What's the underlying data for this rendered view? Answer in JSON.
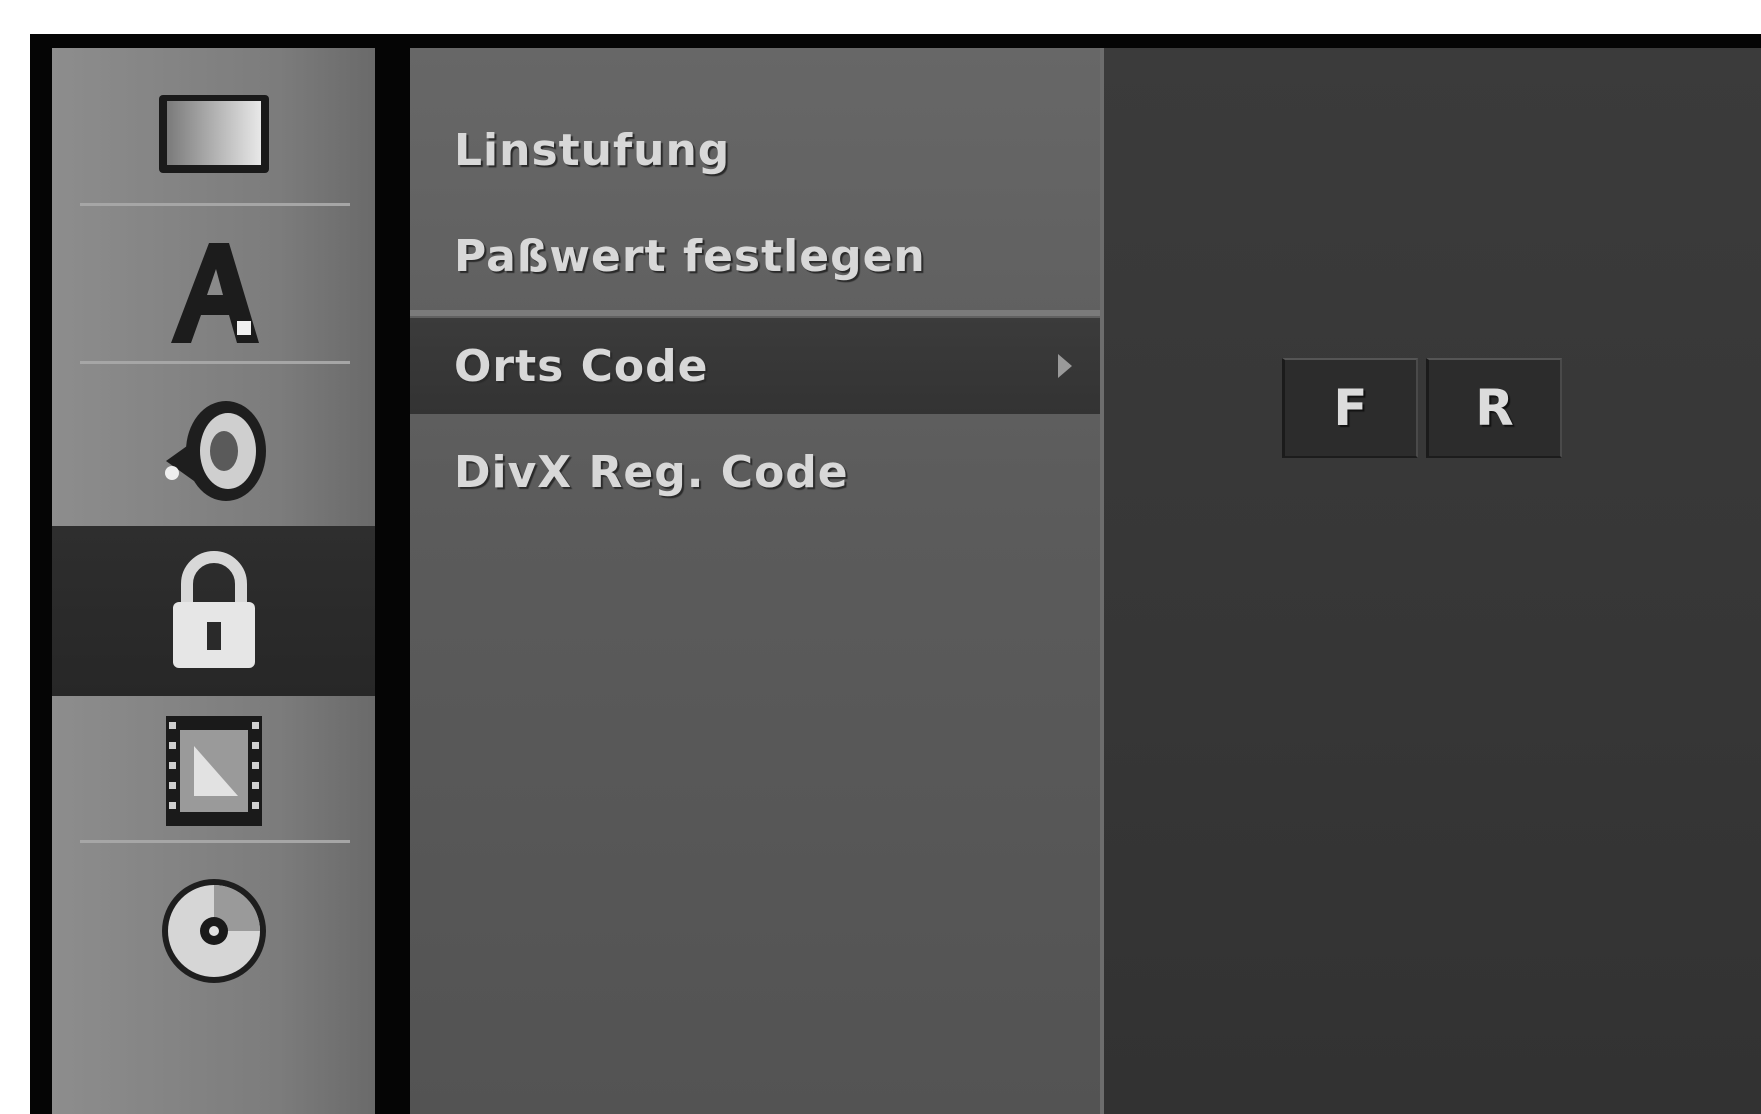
{
  "sidebar": {
    "items": [
      {
        "icon": "display-icon"
      },
      {
        "icon": "language-icon"
      },
      {
        "icon": "speaker-icon"
      },
      {
        "icon": "lock-icon",
        "active": true
      },
      {
        "icon": "film-icon"
      },
      {
        "icon": "disc-icon"
      }
    ]
  },
  "menu": {
    "items": [
      {
        "label": "Linstufung"
      },
      {
        "label": "Paßwert festlegen"
      },
      {
        "label": "Orts Code",
        "selected": true
      },
      {
        "label": "DivX Reg. Code"
      }
    ]
  },
  "region_code": {
    "chars": [
      "F",
      "R"
    ]
  },
  "colors": {
    "sidebar": "#8a8a8a",
    "menu": "#5f5f5f",
    "selected": "#363636",
    "panel": "#383838"
  }
}
